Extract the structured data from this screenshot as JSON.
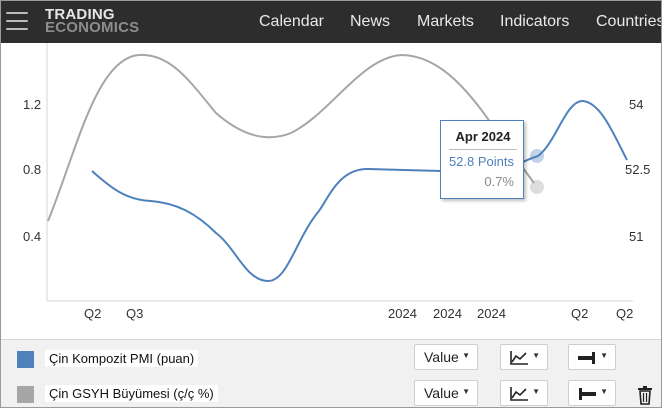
{
  "header": {
    "logo_line1": "TRADING",
    "logo_line2": "ECONOMICS",
    "nav": [
      "Calendar",
      "News",
      "Markets",
      "Indicators",
      "Countries"
    ]
  },
  "chart_data": {
    "type": "line",
    "x": [
      "Q2",
      "Q3",
      "2024",
      "2024",
      "2024",
      "Q2",
      "Q2"
    ],
    "left_axis_ticks": [
      "1.2",
      "0.8",
      "0.4"
    ],
    "right_axis_ticks": [
      "54",
      "52.5",
      "51"
    ],
    "series": [
      {
        "name": "Çin Kompozit PMI (puan)",
        "color": "#4f81bd",
        "axis": "right"
      },
      {
        "name": "Çin GSYH Büyümesi (ç/ç %)",
        "color": "#9e9e9e",
        "axis": "left"
      }
    ],
    "tooltip": {
      "date": "Apr 2024",
      "value1": "52.8 Points",
      "value2": "0.7%"
    }
  },
  "legend": {
    "rows": [
      {
        "name": "Çin Kompozit PMI (puan)",
        "color": "#4f81bd",
        "mode": "Value"
      },
      {
        "name": "Çin GSYH Büyümesi (ç/ç %)",
        "color": "#a6a6a6",
        "mode": "Value"
      }
    ]
  }
}
